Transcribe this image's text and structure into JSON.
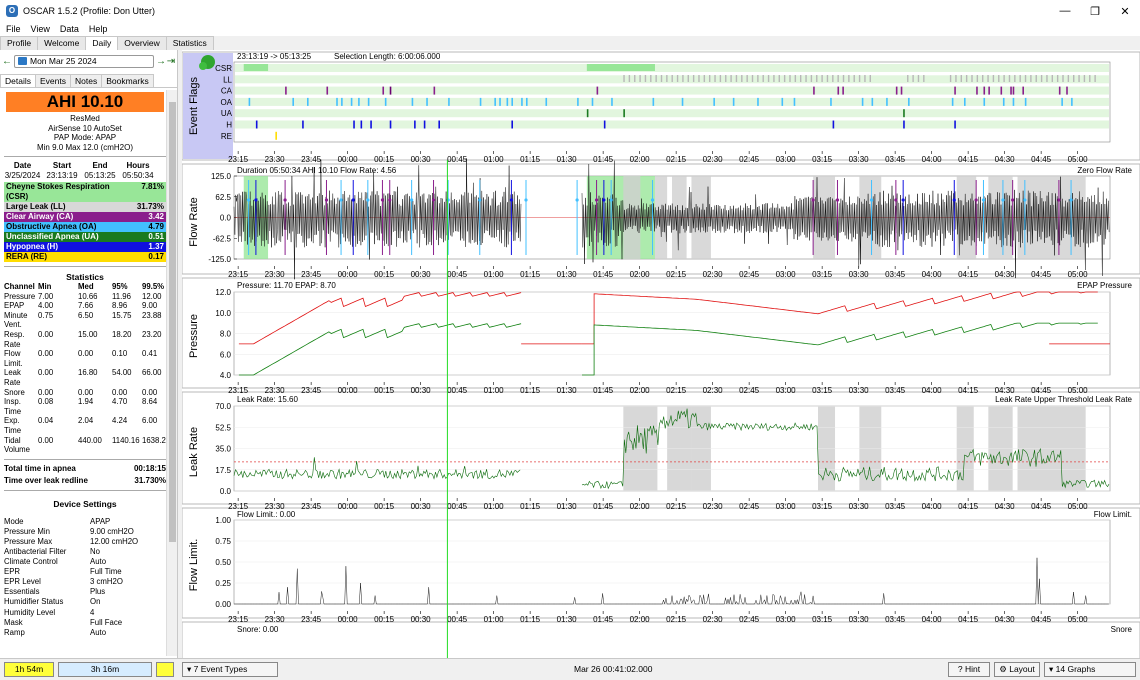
{
  "window": {
    "title": "OSCAR 1.5.2 (Profile: Don Utter)"
  },
  "menu": [
    "File",
    "View",
    "Data",
    "Help"
  ],
  "tabs": [
    "Profile",
    "Welcome",
    "Daily",
    "Overview",
    "Statistics"
  ],
  "date": "Mon Mar 25 2024",
  "subtabs": [
    "Details",
    "Events",
    "Notes",
    "Bookmarks"
  ],
  "ahi": "AHI 10.10",
  "machine": {
    "brand": "ResMed",
    "model": "AirSense 10 AutoSet",
    "mode": "PAP Mode: APAP",
    "range": "Min 9.0 Max 12.0 (cmH2O)"
  },
  "session": {
    "headers": [
      "Date",
      "Start",
      "End",
      "Hours"
    ],
    "values": [
      "3/25/2024",
      "23:13:19",
      "05:13:25",
      "05:50:34"
    ]
  },
  "events": [
    {
      "label": "Cheyne Stokes Respiration\n(CSR)",
      "value": "7.81%",
      "color": "#98e698"
    },
    {
      "label": "Large Leak (LL)",
      "value": "31.73%",
      "color": "#d8d8d8"
    },
    {
      "label": "Clear Airway (CA)",
      "value": "3.42",
      "color": "#8a1e8c"
    },
    {
      "label": "Obstructive Apnea (OA)",
      "value": "4.79",
      "color": "#42c0ff"
    },
    {
      "label": "Unclassified Apnea (UA)",
      "value": "0.51",
      "color": "#1a7a20"
    },
    {
      "label": "Hypopnea (H)",
      "value": "1.37",
      "color": "#1010e0"
    },
    {
      "label": "RERA (RE)",
      "value": "0.17",
      "color": "#ffdd00"
    }
  ],
  "statistics": {
    "title": "Statistics",
    "headers": [
      "Channel",
      "Min",
      "Med",
      "95%",
      "99.5%"
    ],
    "rows": [
      [
        "Pressure",
        "7.00",
        "10.66",
        "11.96",
        "12.00"
      ],
      [
        "EPAP",
        "4.00",
        "7.66",
        "8.96",
        "9.00"
      ],
      [
        "Minute\nVent.",
        "0.75",
        "6.50",
        "15.75",
        "23.88"
      ],
      [
        "Resp.\nRate",
        "0.00",
        "15.00",
        "18.20",
        "23.20"
      ],
      [
        "Flow\nLimit.",
        "0.00",
        "0.00",
        "0.10",
        "0.41"
      ],
      [
        "Leak\nRate",
        "0.00",
        "16.80",
        "54.00",
        "66.00"
      ],
      [
        "Snore",
        "0.00",
        "0.00",
        "0.00",
        "0.00"
      ],
      [
        "Insp.\nTime",
        "0.08",
        "1.94",
        "4.70",
        "8.64"
      ],
      [
        "Exp.\nTime",
        "0.04",
        "2.04",
        "4.24",
        "6.00"
      ],
      [
        "Tidal\nVolume",
        "0.00",
        "440.00",
        "1140.16",
        "1638.29"
      ]
    ]
  },
  "totals": [
    {
      "label": "Total time in apnea",
      "value": "00:18:15"
    },
    {
      "label": "Time over leak redline",
      "value": "31.730%"
    }
  ],
  "device": {
    "title": "Device Settings",
    "rows": [
      [
        "Mode",
        "APAP"
      ],
      [
        "Pressure Min",
        "9.00 cmH2O"
      ],
      [
        "Pressure Max",
        "12.00 cmH2O"
      ],
      [
        "Antibacterial Filter",
        "No"
      ],
      [
        "Climate Control",
        "Auto"
      ],
      [
        "EPR",
        "Full Time"
      ],
      [
        "EPR Level",
        "3 cmH2O"
      ],
      [
        "Essentials",
        "Plus"
      ],
      [
        "Humidifier Status",
        "On"
      ],
      [
        "Humidity Level",
        "4"
      ],
      [
        "Mask",
        "Full Face"
      ],
      [
        "Ramp",
        "Auto"
      ]
    ]
  },
  "bottom": {
    "time1": "1h 54m",
    "time2": "3h 16m",
    "event_types": "7 Event Types",
    "cursor_time": "Mar 26 00:41:02.000",
    "hint": "Hint",
    "layout": "Layout",
    "graphs_count": "14 Graphs"
  },
  "graphs": {
    "times": [
      "23:15",
      "23:30",
      "23:45",
      "00:00",
      "00:15",
      "00:30",
      "00:45",
      "01:00",
      "01:15",
      "01:30",
      "01:45",
      "02:00",
      "02:15",
      "02:30",
      "02:45",
      "03:00",
      "03:15",
      "03:30",
      "03:45",
      "04:00",
      "04:15",
      "04:30",
      "04:45",
      "05:00"
    ],
    "flags": {
      "header_range": "23:13:19 -> 05:13:25",
      "header_sel": "Selection Length: 6:00:06.000",
      "rows": [
        "CSR",
        "LL",
        "CA",
        "OA",
        "UA",
        "H",
        "RE"
      ],
      "ylabel": "Event Flags"
    },
    "flow": {
      "ylabel": "Flow Rate",
      "info": "Duration 05:50:34 AHI 10.10 Flow Rate: 4.56",
      "legend": "Zero  Flow Rate",
      "ticks": [
        "125.0",
        "62.5",
        "0.0",
        "-62.5",
        "-125.0"
      ]
    },
    "pressure": {
      "ylabel": "Pressure",
      "info": "Pressure: 11.70 EPAP: 8.70",
      "legend": "EPAP  Pressure",
      "ticks": [
        "12.0",
        "10.0",
        "8.0",
        "6.0",
        "4.0"
      ]
    },
    "leak": {
      "ylabel": "Leak Rate",
      "info": "Leak Rate: 15.60",
      "legend": "Leak Rate Upper Threshold  Leak Rate",
      "ticks": [
        "70.0",
        "52.5",
        "35.0",
        "17.5",
        "0.0"
      ]
    },
    "flowlim": {
      "ylabel": "Flow Limit.",
      "info": "Flow Limit.: 0.00",
      "legend": "Flow Limit.",
      "ticks": [
        "1.00",
        "0.75",
        "0.50",
        "0.25",
        "0.00"
      ]
    },
    "snore": {
      "info": "Snore: 0.00",
      "legend": "Snore"
    }
  },
  "colors": {
    "csr": "#98e698",
    "ll": "#d8d8d8",
    "ca": "#8a1e8c",
    "oa": "#42c0ff",
    "ua": "#1a7a20",
    "h": "#1010e0",
    "re": "#ffdd00",
    "pressure": "#e01010",
    "epap": "#108010",
    "leak": "#0a6a0a"
  }
}
